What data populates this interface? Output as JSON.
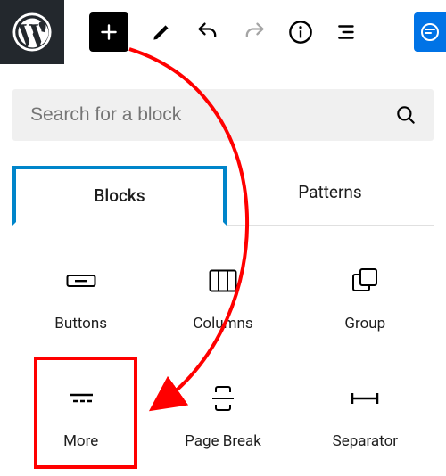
{
  "toolbar": {
    "logo": "wordpress",
    "add_tooltip": "Add block",
    "info_tooltip": "Details"
  },
  "search": {
    "placeholder": "Search for a block"
  },
  "tabs": {
    "blocks": "Blocks",
    "patterns": "Patterns",
    "active": "blocks"
  },
  "blocks": [
    {
      "id": "buttons",
      "label": "Buttons"
    },
    {
      "id": "columns",
      "label": "Columns"
    },
    {
      "id": "group",
      "label": "Group"
    },
    {
      "id": "more",
      "label": "More"
    },
    {
      "id": "page-break",
      "label": "Page Break"
    },
    {
      "id": "separator",
      "label": "Separator"
    }
  ],
  "annotation": {
    "highlighted_block": "more",
    "arrow_from": "add-button",
    "arrow_to": "more"
  }
}
